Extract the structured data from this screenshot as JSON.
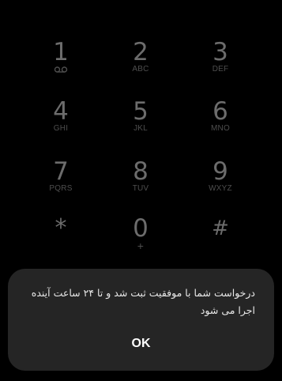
{
  "keypad": {
    "keys": [
      {
        "digit": "1",
        "sub_icon": "voicemail-icon"
      },
      {
        "digit": "2",
        "letters": "ABC"
      },
      {
        "digit": "3",
        "letters": "DEF"
      },
      {
        "digit": "4",
        "letters": "GHI"
      },
      {
        "digit": "5",
        "letters": "JKL"
      },
      {
        "digit": "6",
        "letters": "MNO"
      },
      {
        "digit": "7",
        "letters": "PQRS"
      },
      {
        "digit": "8",
        "letters": "TUV"
      },
      {
        "digit": "9",
        "letters": "WXYZ"
      },
      {
        "digit": "*",
        "letters": ""
      },
      {
        "digit": "0",
        "letters": "+"
      },
      {
        "digit": "#",
        "letters": ""
      }
    ]
  },
  "dialog": {
    "message": "درخواست شما با موفقیت ثبت شد و تا ۲۴ ساعت آینده اجرا می شود",
    "ok_label": "OK"
  },
  "colors": {
    "background": "#000000",
    "key_digit": "#6c6c6c",
    "key_letters": "#4e4e4e",
    "dialog_background": "#252525",
    "dialog_text": "#e8e8e8",
    "ok_text": "#ffffff"
  }
}
